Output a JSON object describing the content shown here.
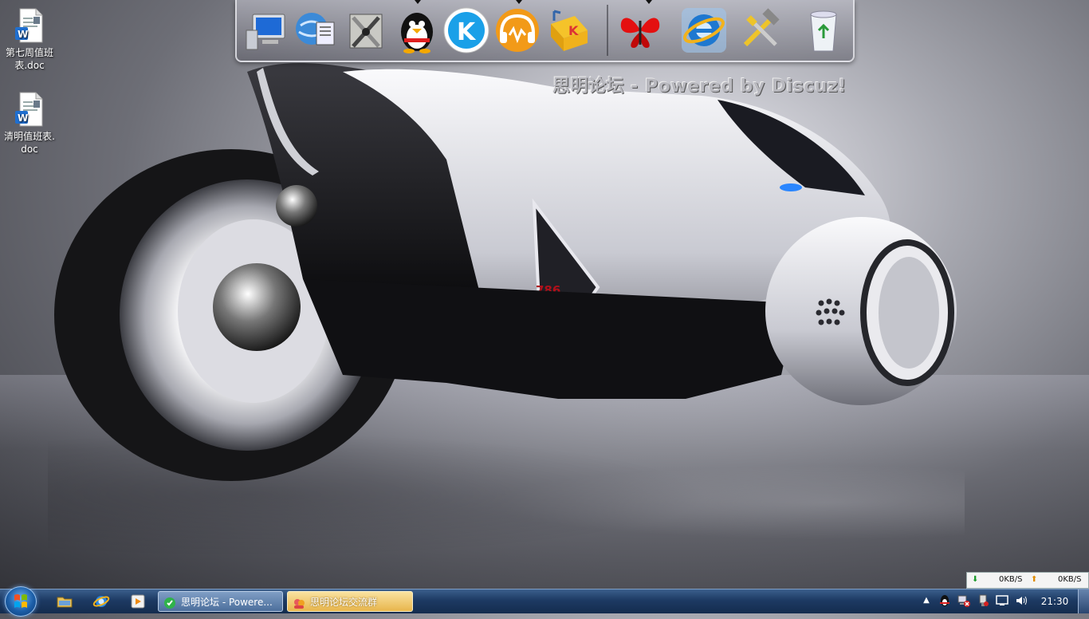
{
  "desktop": {
    "icons": [
      {
        "label": "第七周值班表.doc",
        "line1": "第七周值班",
        "line2": "表.doc",
        "icon": "word-doc-icon"
      },
      {
        "label": "清明值班表.doc",
        "line1": "清明值班表.",
        "line2": "doc",
        "icon": "word-doc-icon"
      }
    ],
    "wallpaper_text": "思明论坛 - Powered by Discuz!",
    "wallpaper_label": "786"
  },
  "dock": {
    "items": [
      {
        "name": "my-computer-icon"
      },
      {
        "name": "network-globe-icon"
      },
      {
        "name": "tools-icon"
      },
      {
        "name": "qq-penguin-icon"
      },
      {
        "name": "kugou-icon"
      },
      {
        "name": "music-player-icon"
      },
      {
        "name": "kuwo-music-icon"
      },
      {
        "name": "butterfly-icon"
      },
      {
        "name": "internet-explorer-icon"
      },
      {
        "name": "hammer-tools-icon"
      },
      {
        "name": "recycle-bin-icon"
      }
    ]
  },
  "network": {
    "down": "0KB/S",
    "up": "0KB/S"
  },
  "taskbar": {
    "quick_launch": [
      "explorer-folder-icon",
      "internet-explorer-icon",
      "media-player-icon"
    ],
    "tasks": [
      {
        "label": "思明论坛 - Powere...",
        "icon": "ie-task-icon",
        "active": true
      },
      {
        "label": "思明论坛交流群",
        "icon": "qq-group-icon",
        "active": false
      }
    ],
    "tray": [
      "show-hidden-icons",
      "qq-tray-icon",
      "network-warning-icon",
      "usb-icon",
      "action-center-icon",
      "volume-icon"
    ],
    "clock": "21:30",
    "colors": {
      "taskbar": "#1d3a63",
      "accent": "#3b5f8c"
    }
  }
}
